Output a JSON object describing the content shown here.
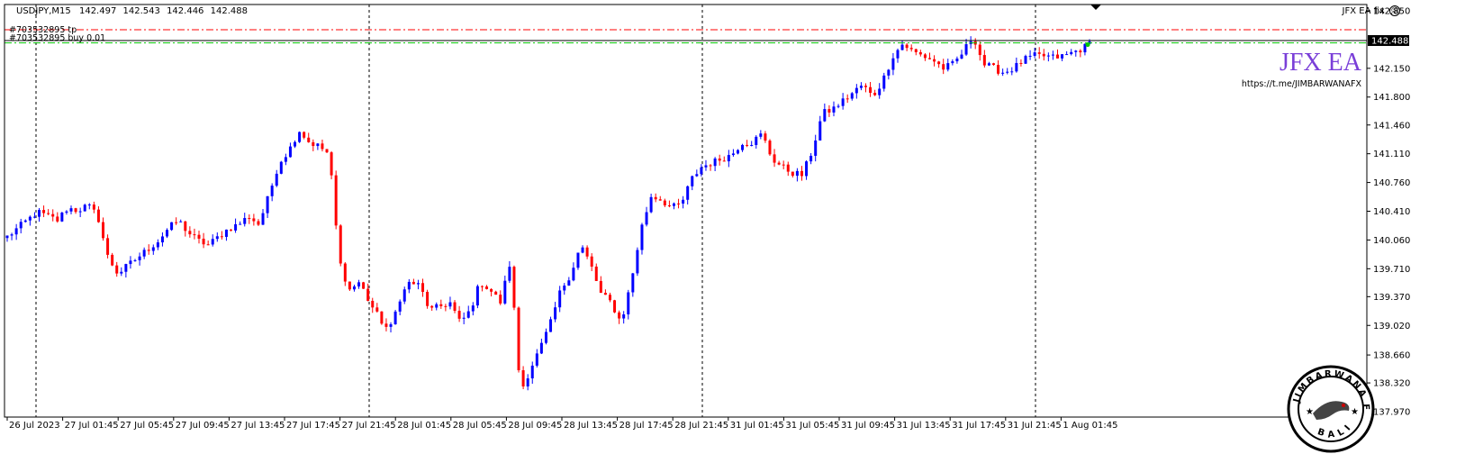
{
  "header": {
    "symbol": "USDJPY,M15",
    "ohlc": [
      "142.497",
      "142.543",
      "142.446",
      "142.488"
    ]
  },
  "ea": {
    "name": "JFX EA fix",
    "icon": "smiley-icon"
  },
  "orders": {
    "tp_label": "#703532895 tp",
    "buy_label": "#703532895 buy 0.01",
    "tp_price": 142.62,
    "open_price": 142.46,
    "tp_color": "#ff0000",
    "open_color": "#00c800"
  },
  "brand": {
    "title": "JFX EA",
    "link": "https://t.me/JIMBARWANAFX",
    "title_color": "#7a3fd8",
    "logo_text": "JIMBARWANA FX",
    "logo_bottom_text": "BALI"
  },
  "colors": {
    "bull": "#0000ff",
    "bear": "#ff0000",
    "bid_line": "#000000",
    "background": "#ffffff"
  },
  "chart_data": {
    "type": "candlestick",
    "symbol": "USDJPY",
    "timeframe": "M15",
    "y_ticks": [
      "142.850",
      "142.488",
      "142.150",
      "141.800",
      "141.460",
      "141.110",
      "140.760",
      "140.410",
      "140.060",
      "139.710",
      "139.370",
      "139.020",
      "138.660",
      "138.320",
      "137.970"
    ],
    "y_tick_values": [
      142.85,
      142.15,
      141.8,
      141.46,
      141.11,
      140.76,
      140.41,
      140.06,
      139.71,
      139.37,
      139.02,
      138.66,
      138.32,
      137.97
    ],
    "ylim": [
      137.97,
      142.85
    ],
    "x_ticks": [
      "26 Jul 2023",
      "27 Jul 01:45",
      "27 Jul 05:45",
      "27 Jul 09:45",
      "27 Jul 13:45",
      "27 Jul 17:45",
      "27 Jul 21:45",
      "28 Jul 01:45",
      "28 Jul 05:45",
      "28 Jul 09:45",
      "28 Jul 13:45",
      "28 Jul 17:45",
      "28 Jul 21:45",
      "31 Jul 01:45",
      "31 Jul 05:45",
      "31 Jul 09:45",
      "31 Jul 13:45",
      "31 Jul 17:45",
      "31 Jul 21:45",
      "1 Aug 01:45"
    ],
    "current_bid": 142.488,
    "grid": false,
    "path": [
      140.1,
      140.2,
      140.3,
      140.4,
      140.35,
      140.3,
      140.45,
      140.42,
      140.48,
      140.35,
      139.85,
      139.65,
      139.75,
      139.85,
      139.95,
      140.05,
      140.2,
      140.3,
      140.15,
      140.05,
      140.0,
      140.1,
      140.2,
      140.25,
      140.35,
      140.25,
      140.6,
      141.0,
      141.15,
      141.4,
      141.25,
      141.2,
      141.1,
      139.8,
      139.45,
      139.55,
      139.3,
      139.1,
      138.95,
      139.35,
      139.55,
      139.5,
      139.2,
      139.25,
      139.3,
      139.05,
      139.2,
      139.55,
      139.45,
      139.3,
      139.8,
      138.2,
      138.5,
      138.75,
      139.05,
      139.45,
      139.65,
      140.0,
      139.75,
      139.4,
      139.3,
      139.05,
      139.55,
      140.2,
      140.6,
      140.55,
      140.45,
      140.5,
      140.8,
      140.95,
      141.0,
      141.05,
      141.1,
      141.25,
      141.25,
      141.35,
      141.05,
      140.95,
      140.88,
      140.85,
      141.15,
      141.6,
      141.65,
      141.75,
      141.85,
      141.95,
      141.8,
      142.0,
      142.3,
      142.45,
      142.35,
      142.3,
      142.25,
      142.15,
      142.2,
      142.35,
      142.55,
      142.2,
      142.15,
      142.1,
      142.15,
      142.25,
      142.3,
      142.3,
      142.28,
      142.3,
      142.35,
      142.4,
      142.5
    ]
  }
}
